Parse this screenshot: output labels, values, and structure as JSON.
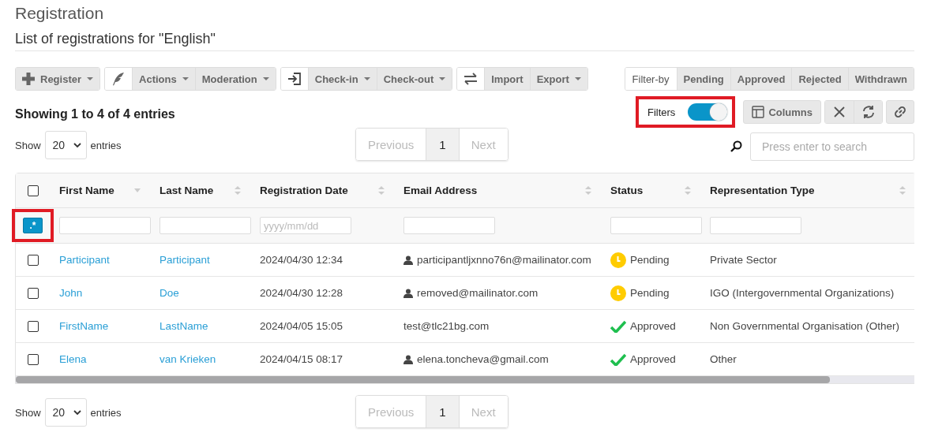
{
  "page": {
    "title": "Registration",
    "subtitle": "List of registrations for \"English\""
  },
  "toolbar": [
    {
      "items": [
        {
          "label": "Register",
          "dropdown": true
        }
      ]
    },
    {
      "items": [
        {
          "label": "Actions",
          "dropdown": true
        },
        {
          "label": "Moderation",
          "dropdown": true
        }
      ]
    },
    {
      "items": [
        {
          "label": "Check-in",
          "dropdown": true
        },
        {
          "label": "Check-out",
          "dropdown": true
        }
      ]
    },
    {
      "items": [
        {
          "label": "Import",
          "dropdown": false
        },
        {
          "label": "Export",
          "dropdown": true
        }
      ]
    }
  ],
  "filter_by": {
    "label": "Filter-by",
    "options": [
      {
        "label": "Pending",
        "selected": false
      },
      {
        "label": "Approved",
        "selected": false
      },
      {
        "label": "Rejected",
        "selected": false
      },
      {
        "label": "Withdrawn",
        "selected": false
      }
    ]
  },
  "summary": "Showing 1 to 4 of 4 entries",
  "filters_toggle": {
    "label": "Filters",
    "on": true
  },
  "columns_button": "Columns",
  "length_top": {
    "before": "Show",
    "value": "20",
    "after": "entries"
  },
  "pagination_top": {
    "previous": {
      "label": "Previous",
      "disabled": true
    },
    "pages": [
      {
        "label": "1",
        "selected": true
      }
    ],
    "next": {
      "label": "Next",
      "disabled": true
    }
  },
  "search": {
    "placeholder": "Press enter to search"
  },
  "table": {
    "regex_button": ".*",
    "columns": [
      {
        "label": "First Name",
        "sorted_descending": true
      },
      {
        "label": "Last Name",
        "sorted_descending": false
      },
      {
        "label": "Registration Date",
        "sorted_descending": false,
        "filter_placeholder": "yyyy/mm/dd"
      },
      {
        "label": "Email Address",
        "sorted_descending": false
      },
      {
        "label": "Status",
        "sorted_descending": false
      },
      {
        "label": "Representation Type",
        "sorted_descending": false
      }
    ],
    "select_all_checked": false,
    "rows": [
      {
        "checked": false,
        "first_name": "Participant",
        "last_name": "Participant",
        "date": "2024/04/30 12:34",
        "email": "participantljxnno76n@mailinator.com",
        "has_account": true,
        "status": {
          "kind": "pending",
          "label": "Pending"
        },
        "representation": "Private Sector"
      },
      {
        "checked": false,
        "first_name": "John",
        "last_name": "Doe",
        "date": "2024/04/30 12:28",
        "email": "removed@mailinator.com",
        "has_account": true,
        "status": {
          "kind": "pending",
          "label": "Pending"
        },
        "representation": "IGO (Intergovernmental Organizations)"
      },
      {
        "checked": false,
        "first_name": "FirstName",
        "last_name": "LastName",
        "date": "2024/04/05 15:05",
        "email": "test@tlc21bg.com",
        "has_account": false,
        "status": {
          "kind": "approved",
          "label": "Approved"
        },
        "representation": "Non Governmental Organisation (Other)"
      },
      {
        "checked": false,
        "first_name": "Elena",
        "last_name": "van Krieken",
        "date": "2024/04/15 08:17",
        "email": "elena.toncheva@gmail.com",
        "has_account": true,
        "status": {
          "kind": "approved",
          "label": "Approved"
        },
        "representation": "Other"
      }
    ]
  },
  "length_bottom": {
    "before": "Show",
    "value": "20",
    "after": "entries"
  },
  "pagination_bottom": {
    "previous": {
      "label": "Previous",
      "disabled": true
    },
    "pages": [
      {
        "label": "1",
        "selected": true
      }
    ],
    "next": {
      "label": "Next",
      "disabled": true
    }
  }
}
